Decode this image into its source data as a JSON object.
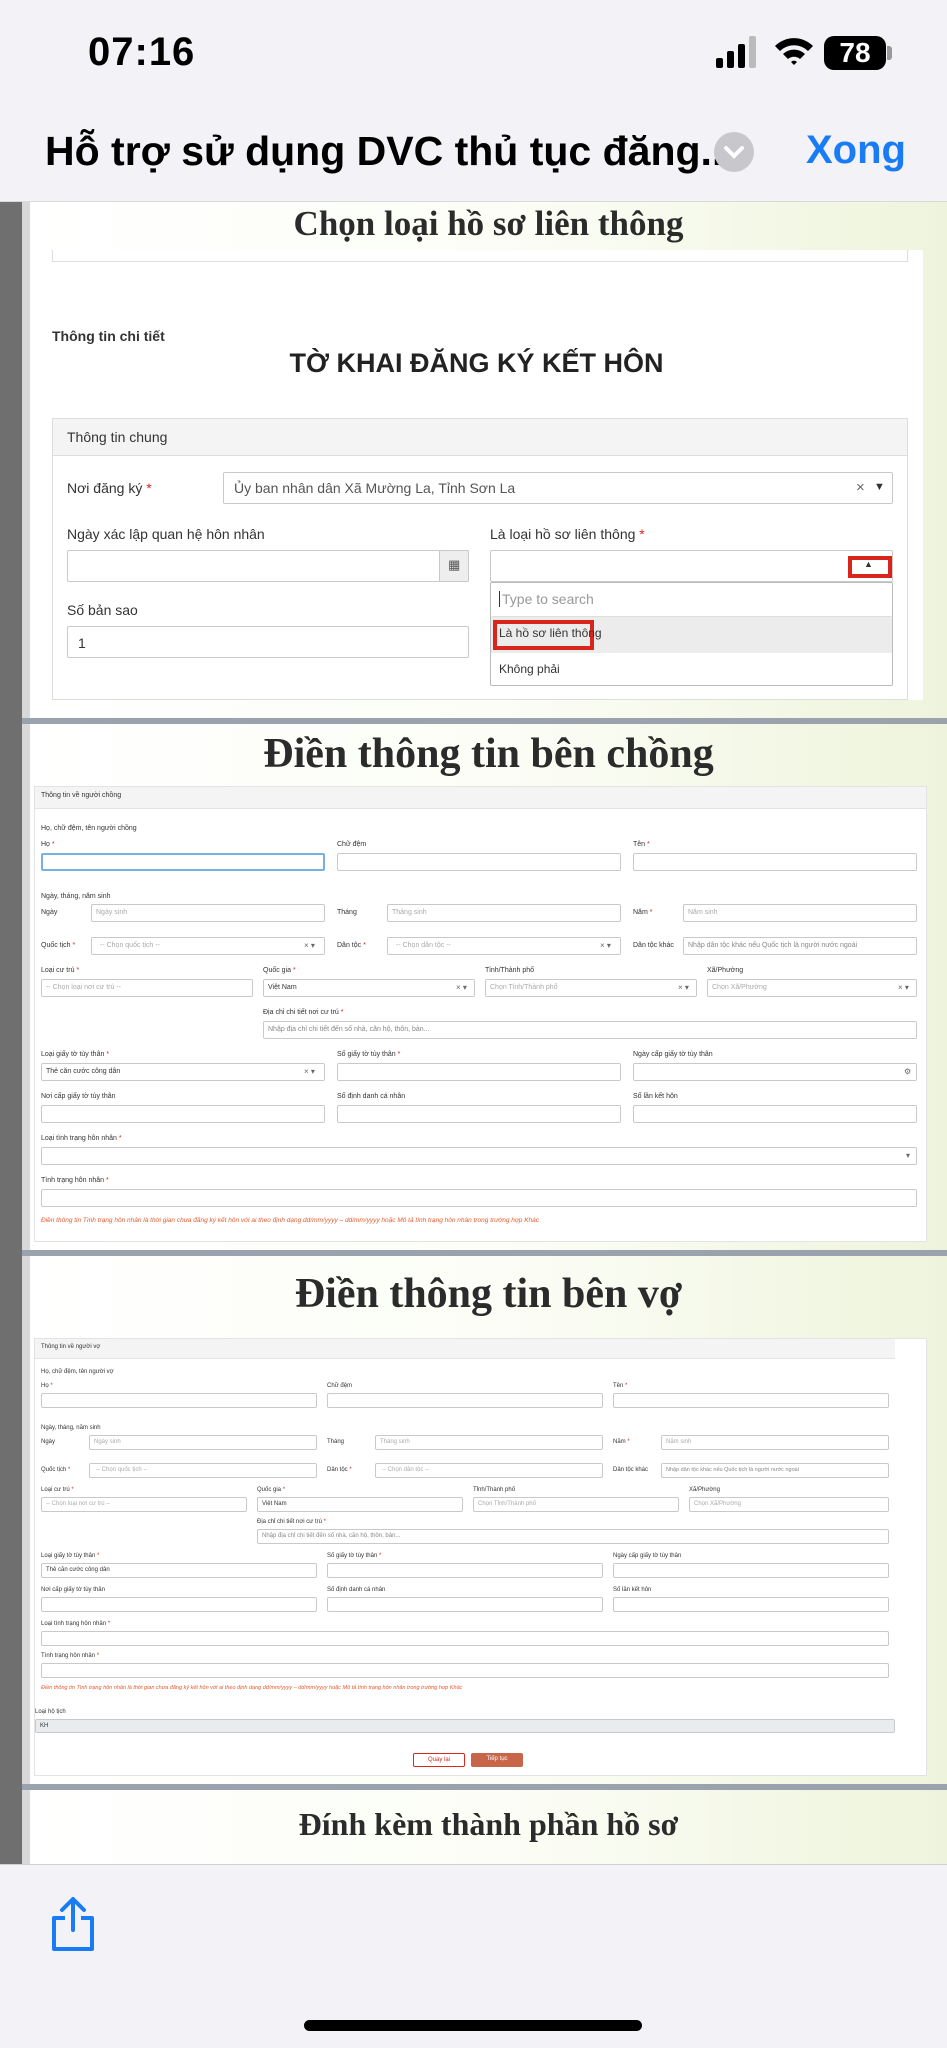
{
  "status": {
    "time": "07:16",
    "battery": "78"
  },
  "nav": {
    "title": "Hỗ trợ sử dụng DVC thủ tục đăng...",
    "done": "Xong"
  },
  "slide1": {
    "title": "Chọn loại hồ sơ liên thông",
    "detail_label": "Thông tin chi tiết",
    "form_title": "TỜ KHAI ĐĂNG KÝ KẾT HÔN",
    "section": "Thông tin chung",
    "noi_dang_ky_label": "Nơi đăng ký",
    "noi_dang_ky_value": "Ủy ban nhân dân Xã Mường La, Tỉnh Sơn La",
    "ngay_xac_lap_label": "Ngày xác lập quan hệ hôn nhân",
    "loai_ho_so_label": "Là loại hồ sơ liên thông",
    "so_ban_sao_label": "Số bản sao",
    "so_ban_sao_value": "1",
    "search_placeholder": "Type to search",
    "options": [
      "Là hồ sơ liên thông",
      "Không phải"
    ]
  },
  "slide2": {
    "title": "Điền thông tin bên chồng",
    "header": "Thông tin về người chồng",
    "name_group": "Họ, chữ đệm, tên người chồng",
    "ho": "Họ",
    "chu_dem": "Chữ đệm",
    "ten": "Tên",
    "dob_group": "Ngày, tháng, năm sinh",
    "ngay": "Ngày",
    "ngay_ph": "Ngày sinh",
    "thang": "Tháng",
    "thang_ph": "Tháng sinh",
    "nam": "Năm",
    "nam_ph": "Năm sinh",
    "quoc_tich": "Quốc tịch",
    "quoc_tich_ph": "-- Chọn quốc tịch --",
    "dan_toc": "Dân tộc",
    "dan_toc_ph": "-- Chọn dân tộc --",
    "dan_toc_khac": "Dân tộc khác",
    "dan_toc_khac_ph": "Nhập dân tộc khác nếu Quốc tịch là người nước ngoài",
    "loai_cu_tru": "Loại cư trú",
    "loai_cu_tru_ph": "-- Chọn loại nơi cư trú --",
    "quoc_gia": "Quốc gia",
    "quoc_gia_value": "Việt Nam",
    "tinh": "Tỉnh/Thành phố",
    "tinh_ph": "Chọn Tỉnh/Thành phố",
    "xa": "Xã/Phường",
    "xa_ph": "Chọn Xã/Phường",
    "dia_chi": "Địa chỉ chi tiết nơi cư trú",
    "dia_chi_ph": "Nhập địa chỉ chi tiết đến số nhà, căn hộ, thôn, bản...",
    "loai_giay": "Loại giấy tờ tùy thân",
    "loai_giay_value": "Thẻ căn cước công dân",
    "so_giay": "Số giấy tờ tùy thân",
    "ngay_cap": "Ngày cấp giấy tờ tùy thân",
    "noi_cap": "Nơi cấp giấy tờ tùy thân",
    "so_dinh_danh": "Số định danh cá nhân",
    "so_lan": "Số lần kết hôn",
    "loai_tinh_trang": "Loại tình trạng hôn nhân",
    "tinh_trang": "Tình trạng hôn nhân",
    "note": "Điền thông tin Tình trạng hôn nhân là thời gian chưa đăng ký kết hôn với ai theo định dạng dd/mm/yyyy – dd/mm/yyyy hoặc Mô tả tình trạng hôn nhân trong trường hợp Khác"
  },
  "slide3": {
    "title": "Điền thông tin bên vợ",
    "header": "Thông tin về người vợ",
    "name_group": "Họ, chữ đệm, tên người vợ",
    "loai_ho_tich": "Loại hộ tịch",
    "loai_ho_tich_value": "KH",
    "back": "Quay lại",
    "next": "Tiếp tục"
  },
  "slide4": {
    "title": "Đính kèm thành phần hồ sơ"
  },
  "colors": {
    "accent": "#1a7cf5",
    "highlight": "#d9261c",
    "next_button": "#c8664a"
  },
  "icons": {
    "share": "share-icon",
    "chevron": "chevron-down-icon",
    "calendar": "calendar-icon"
  }
}
